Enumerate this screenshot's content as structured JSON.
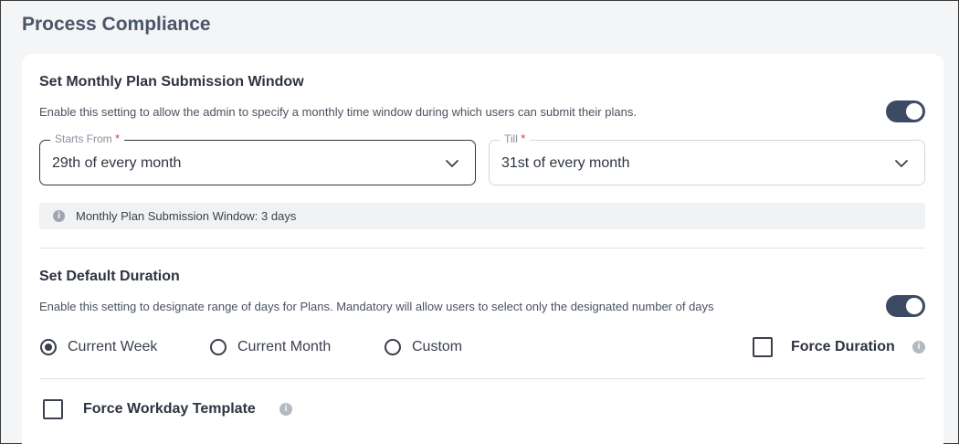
{
  "page": {
    "title": "Process Compliance"
  },
  "submission_window": {
    "title": "Set Monthly Plan Submission Window",
    "description": "Enable this setting to allow the admin to specify a monthly time window during which users can submit their plans.",
    "enabled": true,
    "starts_from": {
      "label": "Starts From",
      "required_mark": "*",
      "value": "29th of every month"
    },
    "till": {
      "label": "Till",
      "required_mark": "*",
      "value": "31st of every month"
    },
    "info_text": "Monthly Plan Submission Window: 3 days"
  },
  "default_duration": {
    "title": "Set Default Duration",
    "description": "Enable this setting to designate range of days for Plans. Mandatory will allow users to select only the designated number of days",
    "enabled": true,
    "options": [
      {
        "label": "Current Week",
        "checked": true
      },
      {
        "label": "Current Month",
        "checked": false
      },
      {
        "label": "Custom",
        "checked": false
      }
    ],
    "force_duration_label": "Force Duration"
  },
  "workday_template": {
    "label": "Force Workday Template"
  },
  "colors": {
    "toggle_on": "#3c4a63",
    "required": "#e53935"
  }
}
